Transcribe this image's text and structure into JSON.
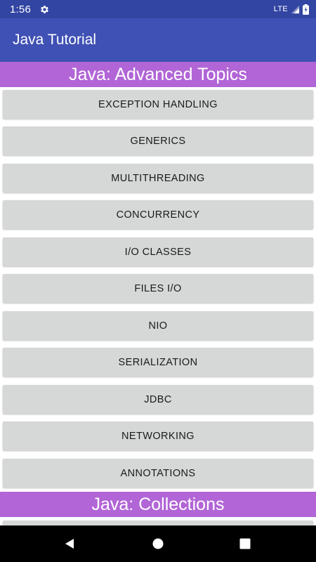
{
  "status_bar": {
    "time": "1:56",
    "network": "LTE",
    "icons": [
      "gear-icon",
      "signal-icon",
      "battery-icon"
    ]
  },
  "app_bar": {
    "title": "Java Tutorial",
    "color": "#3f51b5"
  },
  "sections": [
    {
      "title": "Java: Advanced Topics",
      "color": "#b165d6",
      "items": [
        "EXCEPTION HANDLING",
        "GENERICS",
        "MULTITHREADING",
        "CONCURRENCY",
        "I/O CLASSES",
        "FILES I/O",
        "NIO",
        "SERIALIZATION",
        "JDBC",
        "NETWORKING",
        "ANNOTATIONS"
      ]
    },
    {
      "title": "Java: Collections",
      "color": "#b165d6",
      "items": [
        ""
      ]
    }
  ],
  "nav_bar": {
    "icons": [
      "back-icon",
      "home-icon",
      "recents-icon"
    ]
  }
}
